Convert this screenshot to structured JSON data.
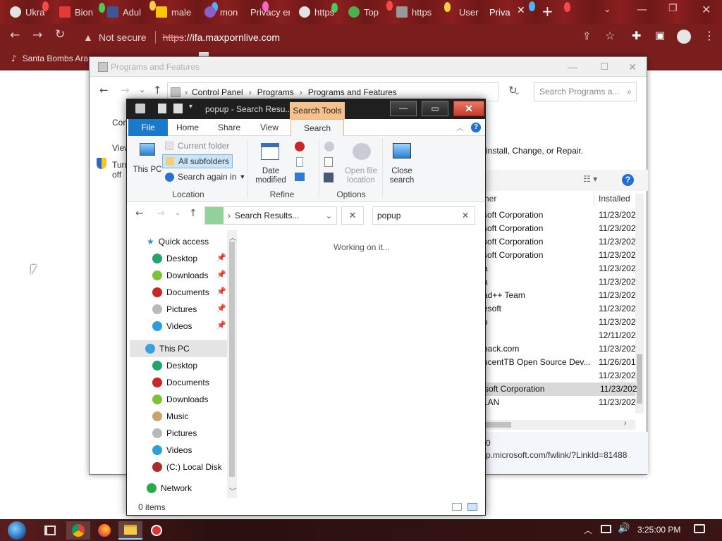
{
  "browser": {
    "tabs": [
      {
        "label": "Ukra",
        "favicon_color": "#e3e3e3",
        "favicon": "globe-icon"
      },
      {
        "label": "Bion",
        "favicon_color": "#e53935",
        "favicon": "f-icon"
      },
      {
        "label": "Adul",
        "favicon_color": "#3b5998",
        "favicon": "w-icon"
      },
      {
        "label": "male",
        "favicon_color": "#f9c600",
        "favicon": "m-icon"
      },
      {
        "label": "mon",
        "favicon_color": "#8a5fc7",
        "favicon": "orb-icon"
      },
      {
        "label": "Privacy er",
        "favicon_color": "#3b7bd8",
        "favicon": "shield-icon"
      },
      {
        "label": "https",
        "favicon_color": "#e3e3e3",
        "favicon": "globe-icon"
      },
      {
        "label": "Top",
        "favicon_color": "#4caf50",
        "favicon": "tree-icon"
      },
      {
        "label": "https",
        "favicon_color": "#999999",
        "favicon": "dots-icon"
      },
      {
        "label": "User",
        "favicon_color": "#a0a0a0",
        "favicon": "doc-icon"
      },
      {
        "label": "Priva",
        "favicon_color": "#a0a0a0",
        "favicon": "doc-icon",
        "active": true
      }
    ],
    "new_tab": "+",
    "security_label": "Not secure",
    "url_scheme": "https",
    "url_rest": "://ifa.maxpornlive.com",
    "bookmark": "Santa Bombs Ara"
  },
  "programs_window": {
    "title": "Programs and Features",
    "breadcrumb": [
      "Control Panel",
      "Programs",
      "Programs and Features"
    ],
    "search_placeholder": "Search Programs a...",
    "left_fragments": [
      "Con",
      "View",
      "Turn",
      "off"
    ],
    "instructions": "install, Change, or Repair.",
    "col_publisher": "her",
    "col_installed": "Installed",
    "rows": [
      {
        "publisher": "soft Corporation",
        "date": "11/23/202"
      },
      {
        "publisher": "soft Corporation",
        "date": "11/23/202"
      },
      {
        "publisher": "soft Corporation",
        "date": "11/23/202"
      },
      {
        "publisher": "soft Corporation",
        "date": "11/23/202"
      },
      {
        "publisher": "a",
        "date": "11/23/202"
      },
      {
        "publisher": "a",
        "date": "11/23/202"
      },
      {
        "publisher": "ad++ Team",
        "date": "11/23/202"
      },
      {
        "publisher": "esoft",
        "date": "11/23/202"
      },
      {
        "publisher": "p",
        "date": "11/23/202"
      },
      {
        "publisher": "",
        "date": "12/11/202"
      },
      {
        "publisher": "back.com",
        "date": "11/23/202"
      },
      {
        "publisher": "ucentTB Open Source Dev...",
        "date": "11/26/201"
      },
      {
        "publisher": "",
        "date": "11/23/202"
      },
      {
        "publisher": "soft Corporation",
        "date": "11/23/202",
        "selected": true
      },
      {
        "publisher": "LAN",
        "date": "11/23/202"
      }
    ],
    "details_line1": "0",
    "details_line2": "p.microsoft.com/fwlink/?LinkId=81488"
  },
  "explorer": {
    "title": "popup - Search Resu...",
    "contextual_tab": "Search Tools",
    "ribbon_tabs": [
      "File",
      "Home",
      "Share",
      "View",
      "Search"
    ],
    "ribbon": {
      "this_pc": "This PC",
      "current_folder": "Current folder",
      "all_subfolders": "All subfolders",
      "search_again": "Search again in",
      "location_group": "Location",
      "date_modified": "Date modified",
      "refine_group": "Refine",
      "open_file_location": "Open file location",
      "close_search": "Close search",
      "options_group": "Options"
    },
    "address": "Search Results...",
    "search_value": "popup",
    "status_message": "Working on it...",
    "tree": {
      "quick_access": "Quick access",
      "quick_items": [
        "Desktop",
        "Downloads",
        "Documents",
        "Pictures",
        "Videos"
      ],
      "this_pc": "This PC",
      "pc_items": [
        "Desktop",
        "Documents",
        "Downloads",
        "Music",
        "Pictures",
        "Videos",
        "(C:) Local Disk"
      ],
      "network": "Network"
    },
    "item_count": "0 items"
  },
  "taskbar": {
    "clock": "3:25:00 PM"
  }
}
